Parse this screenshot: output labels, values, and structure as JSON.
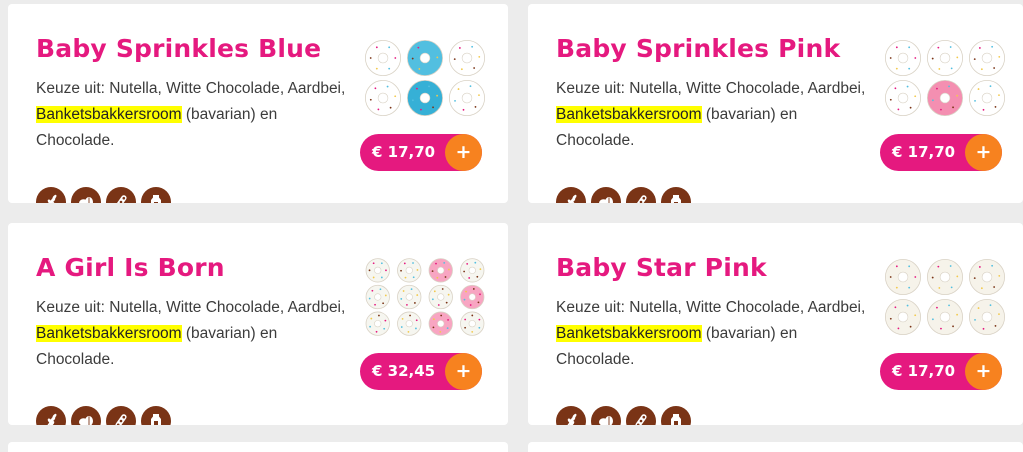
{
  "products": [
    {
      "name": "Baby Sprinkles Blue",
      "desc_prefix": "Keuze uit: Nutella, Witte Chocolade, Aardbei, ",
      "desc_highlight": "Banketsbakkersroom",
      "desc_suffix": " (bavarian) en Chocolade.",
      "price": "€ 17,70",
      "add_label": "+",
      "image": "donuts-blue-thumbnail",
      "allergens": [
        "wheat-icon",
        "nuts-icon",
        "soy-icon",
        "milk-icon"
      ],
      "colors": [
        "#ffffff",
        "#52bfe0",
        "#ffffff",
        "#ffffff",
        "#36b0d6",
        "#ffffff"
      ]
    },
    {
      "name": "Baby Sprinkles Pink",
      "desc_prefix": "Keuze uit: Nutella, Witte Chocolade, Aardbei, ",
      "desc_highlight": "Banketsbakkersroom",
      "desc_suffix": " (bavarian) en Chocolade.",
      "price": "€ 17,70",
      "add_label": "+",
      "image": "donuts-pink-thumbnail",
      "allergens": [
        "wheat-icon",
        "nuts-icon",
        "soy-icon",
        "milk-icon"
      ],
      "colors": [
        "#ffffff",
        "#ffffff",
        "#ffffff",
        "#ffffff",
        "#f48fb1",
        "#ffffff"
      ]
    },
    {
      "name": "A Girl Is Born",
      "desc_prefix": "Keuze uit: Nutella, Witte Chocolade, Aardbei, ",
      "desc_highlight": "Banketsbakkersroom",
      "desc_suffix": " (bavarian) en Chocolade.",
      "price": "€ 32,45",
      "add_label": "+",
      "image": "donuts-girl-thumbnail",
      "allergens": [
        "wheat-icon",
        "nuts-icon",
        "soy-icon",
        "milk-icon"
      ],
      "colors": [
        "#f6f6f0",
        "#f6f6f0",
        "#f8a5c2",
        "#f6f6f0",
        "#f6f6f0",
        "#f6f6f0",
        "#f6f6f0",
        "#f8a5c2",
        "#f6f6f0",
        "#f6f6f0",
        "#f8a5c2",
        "#f6f6f0"
      ]
    },
    {
      "name": "Baby Star Pink",
      "desc_prefix": "Keuze uit: Nutella, Witte Chocolade, Aardbei, ",
      "desc_highlight": "Banketsbakkersroom",
      "desc_suffix": " (bavarian) en Chocolade.",
      "price": "€ 17,70",
      "add_label": "+",
      "image": "donuts-star-thumbnail",
      "allergens": [
        "wheat-icon",
        "nuts-icon",
        "soy-icon",
        "milk-icon"
      ],
      "colors": [
        "#f6f3ea",
        "#f6f3ea",
        "#f6f3ea",
        "#f6f3ea",
        "#f6f3ea",
        "#f6f3ea"
      ]
    }
  ]
}
